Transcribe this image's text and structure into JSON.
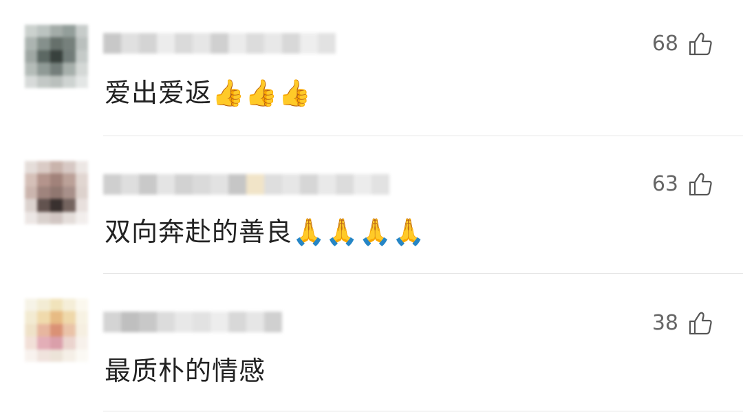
{
  "comments": [
    {
      "text": "爱出爱返👍👍👍",
      "likes": "68",
      "avatar_colors": [
        "#c9cfcc",
        "#b8c0bd",
        "#9fa8a4",
        "#8e9995",
        "#c5cac8",
        "#a8b1ad",
        "#7f8b86",
        "#5e6964",
        "#6f7a75",
        "#b7bdbb",
        "#9aa39f",
        "#54605b",
        "#2e3733",
        "#6b7672",
        "#c2c8c6",
        "#b1b9b5",
        "#8a9591",
        "#6d7874",
        "#a2aba7",
        "#d2d6d4",
        "#d5d9d7",
        "#c0c6c3",
        "#b7bdba",
        "#ccd1cf",
        "#e2e5e4"
      ],
      "username_colors": [
        "#c8c8c8",
        "#e0e0e0",
        "#d4d4d4",
        "#ececec",
        "#dadada",
        "#e6e6e6",
        "#d0d0d0",
        "#ebebeb",
        "#dcdcdc",
        "#e8e8e8",
        "#d8d8d8",
        "#eeeeee",
        "#e2e2e2"
      ]
    },
    {
      "text": "双向奔赴的善良🙏🙏🙏🙏",
      "likes": "63",
      "avatar_colors": [
        "#e4dcd8",
        "#d9c9c3",
        "#c7b0a8",
        "#d5c6c1",
        "#ece6e3",
        "#d3bdb5",
        "#b08f86",
        "#9d7c73",
        "#b89c93",
        "#e0d4cf",
        "#c9b2aa",
        "#9a7e77",
        "#8b7069",
        "#a48b84",
        "#dcd0cb",
        "#dad0cc",
        "#5a4a46",
        "#2f2624",
        "#6d5c57",
        "#e7dfdc",
        "#ece6e4",
        "#d8cfcb",
        "#cfc4c0",
        "#e3dcd9",
        "#f2eeec"
      ],
      "username_colors": [
        "#cfcfcf",
        "#dedede",
        "#c9c9c9",
        "#e4e4e4",
        "#d2d2d2",
        "#dadada",
        "#e2e2e2",
        "#c6c6c6",
        "#f1e4c8",
        "#dedede",
        "#e6e6e6",
        "#d6d6d6",
        "#e9e9e9",
        "#dcdcdc",
        "#ececec",
        "#e2e2e2"
      ]
    },
    {
      "text": "最质朴的情感",
      "likes": "38",
      "avatar_colors": [
        "#f6f3e6",
        "#f3ecd2",
        "#f1e2b8",
        "#f5eed6",
        "#fbf8ee",
        "#f3ead0",
        "#f0d9a8",
        "#e6b87e",
        "#efd6a6",
        "#f7f2e2",
        "#efe1c6",
        "#e6b39a",
        "#d98c6e",
        "#e9c0a4",
        "#f6efe0",
        "#f2dfd6",
        "#e2aab4",
        "#d99aa6",
        "#ead2cc",
        "#f7f1ea",
        "#f8f2ee",
        "#f0e2dc",
        "#ece2d6",
        "#f5efe6",
        "#fbf9f4"
      ],
      "username_colors": [
        "#d4d4d4",
        "#bfbfbf",
        "#c8c8c8",
        "#dcdcdc",
        "#e8e8e8",
        "#e2e2e2",
        "#ededed",
        "#d8d8d8",
        "#e6e6e6",
        "#d0d0d0"
      ]
    }
  ],
  "icons": {
    "like": "thumbs-up-outline-icon"
  },
  "colors": {
    "text": "#222222",
    "like_count": "#666666",
    "divider": "#e6e6e6"
  }
}
